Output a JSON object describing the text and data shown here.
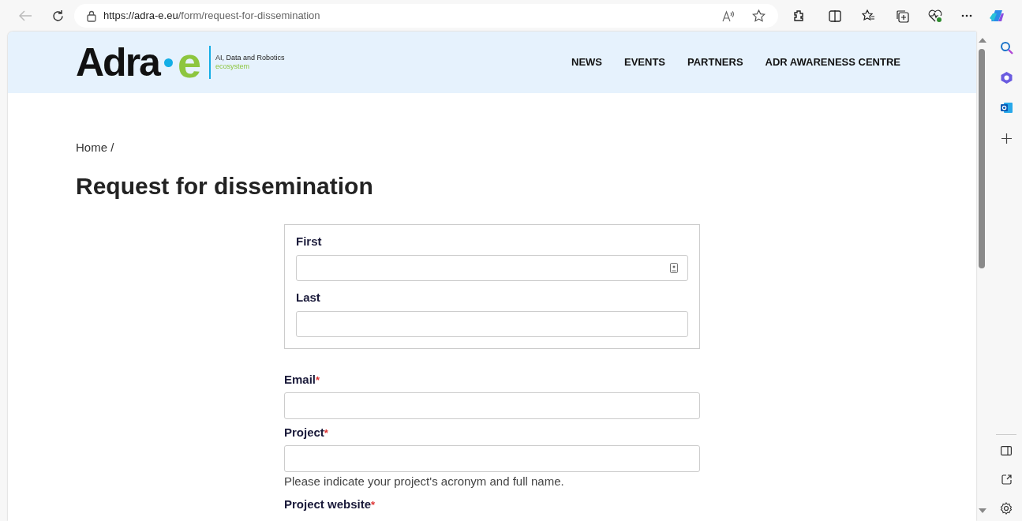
{
  "browser": {
    "url_host": "https://adra-e.eu",
    "url_path": "/form/request-for-dissemination"
  },
  "site": {
    "logo_main": "Adra",
    "logo_end": "e",
    "tagline": "AI, Data and Robotics",
    "tagline_sub": "ecosystem",
    "nav": [
      "NEWS",
      "EVENTS",
      "PARTNERS",
      "ADR AWARENESS CENTRE"
    ]
  },
  "breadcrumb": "Home /",
  "title": "Request for dissemination",
  "name_group": [
    {
      "label": "First",
      "autofill_icon": true
    },
    {
      "label": "Last",
      "autofill_icon": false
    }
  ],
  "fields": [
    {
      "label": "Email",
      "required": true,
      "required_mark": "*"
    },
    {
      "label": "Project",
      "required": true,
      "required_mark": "*",
      "help": "Please indicate your project's acronym and full name."
    },
    {
      "label": "Project website",
      "required": true,
      "required_mark": "*"
    }
  ]
}
